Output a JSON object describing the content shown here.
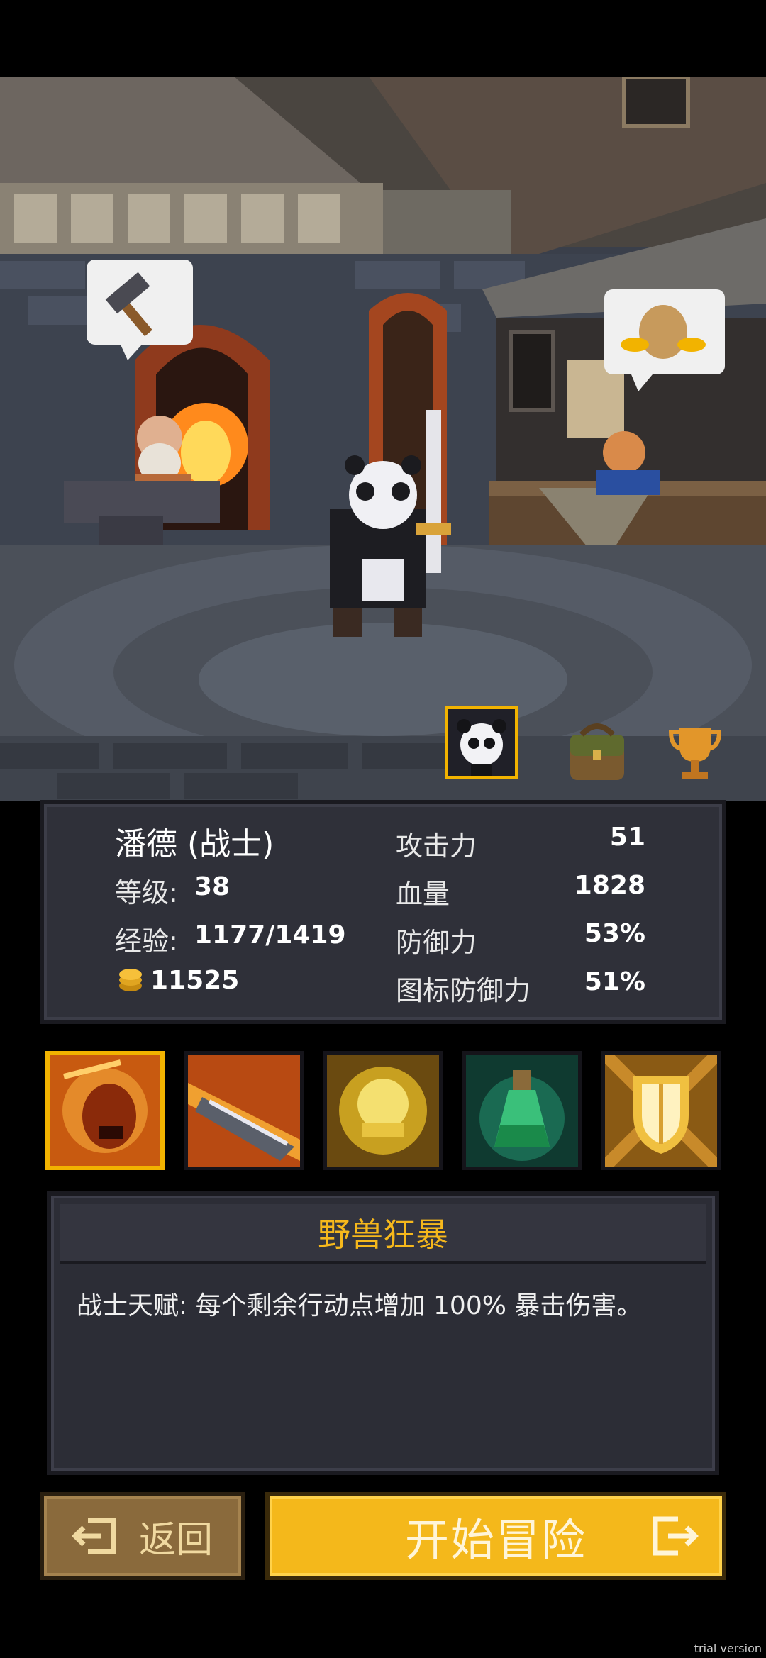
{
  "hero": {
    "name": "潘德 (战士)",
    "level_label": "等级:",
    "level": "38",
    "exp_label": "经验:",
    "exp": "1177/1419",
    "gold": "11525"
  },
  "attributes": [
    {
      "label": "攻击力",
      "value": "51"
    },
    {
      "label": "血量",
      "value": "1828"
    },
    {
      "label": "防御力",
      "value": "53%"
    },
    {
      "label": "图标防御力",
      "value": "51%"
    }
  ],
  "tabs": [
    "panda-portrait-icon",
    "bag-icon",
    "trophy-icon"
  ],
  "skills": [
    {
      "icon": "beast-rage-icon",
      "selected": true
    },
    {
      "icon": "blade-slash-icon",
      "selected": false
    },
    {
      "icon": "golden-burst-icon",
      "selected": false
    },
    {
      "icon": "green-potion-icon",
      "selected": false
    },
    {
      "icon": "golden-shield-icon",
      "selected": false
    }
  ],
  "skill_detail": {
    "title": "野兽狂暴",
    "description": "战士天赋: 每个剩余行动点增加 100% 暴击伤害。"
  },
  "buttons": {
    "back": "返回",
    "start": "开始冒险"
  },
  "watermark": "trial version",
  "colors": {
    "accent": "#f4b81b",
    "panel": "#2f3039",
    "title_gold": "#f6b81c"
  }
}
